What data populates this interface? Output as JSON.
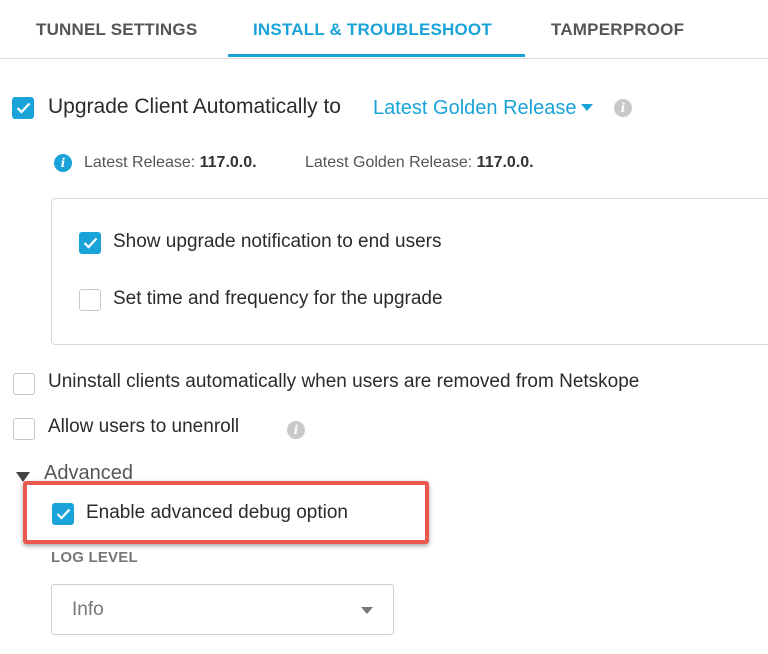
{
  "tabs": [
    {
      "label": "TUNNEL SETTINGS",
      "active": false
    },
    {
      "label": "INSTALL & TROUBLESHOOT",
      "active": true
    },
    {
      "label": "TAMPERPROOF",
      "active": false
    }
  ],
  "upgrade": {
    "checked": true,
    "label": "Upgrade Client Automatically to",
    "selected_release": "Latest Golden Release",
    "info_icon": "info-icon"
  },
  "release_info": {
    "latest_label": "Latest Release:",
    "latest_value": "117.0.0.",
    "golden_label": "Latest Golden Release:",
    "golden_value": "117.0.0."
  },
  "upgrade_options": [
    {
      "label": "Show upgrade notification to end users",
      "checked": true
    },
    {
      "label": "Set time and frequency for the upgrade",
      "checked": false
    }
  ],
  "uninstall": {
    "label": "Uninstall clients automatically when users are removed from Netskope",
    "checked": false
  },
  "unenroll": {
    "label": "Allow users to unenroll",
    "checked": false
  },
  "advanced": {
    "label": "Advanced",
    "expanded": true,
    "debug": {
      "label": "Enable advanced debug option",
      "checked": true
    },
    "log_level_label": "LOG LEVEL",
    "log_level_value": "Info"
  },
  "colors": {
    "accent": "#1aa3d9",
    "highlight": "#e8584f"
  }
}
